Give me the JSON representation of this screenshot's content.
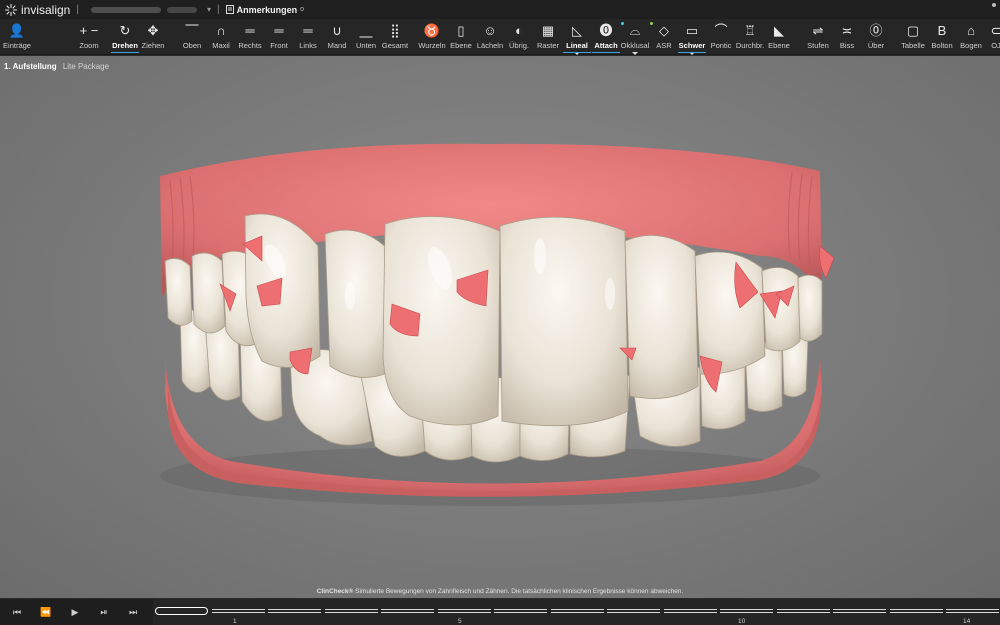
{
  "app": {
    "name": "invisalign",
    "notes_label": "Anmerkungen"
  },
  "toolbar": {
    "tools": [
      {
        "key": "eintraege",
        "label": "Einträge",
        "icon": "person-icon"
      },
      {
        "key": "zoom",
        "label": "Zoom",
        "icon": "zoom-plus-minus-icon"
      },
      {
        "key": "drehen",
        "label": "Drehen",
        "icon": "rotate-icon",
        "active": true
      },
      {
        "key": "ziehen",
        "label": "Ziehen",
        "icon": "move-arrows-icon"
      },
      {
        "key": "oben",
        "label": "Oben",
        "icon": "view-top-icon"
      },
      {
        "key": "maxil",
        "label": "Maxil",
        "icon": "arch-icon"
      },
      {
        "key": "rechts",
        "label": "Rechts",
        "icon": "view-right-icon"
      },
      {
        "key": "front",
        "label": "Front",
        "icon": "view-front-icon"
      },
      {
        "key": "links",
        "label": "Links",
        "icon": "view-left-icon"
      },
      {
        "key": "mand",
        "label": "Mand",
        "icon": "mandible-icon"
      },
      {
        "key": "unten",
        "label": "Unten",
        "icon": "view-bottom-icon"
      },
      {
        "key": "gesamt",
        "label": "Gesamt",
        "icon": "grid-dots-icon"
      },
      {
        "key": "wurzeln",
        "label": "Wurzeln",
        "icon": "tooth-root-icon"
      },
      {
        "key": "ebene",
        "label": "Ebene",
        "icon": "plane-icon"
      },
      {
        "key": "laecheln",
        "label": "Lächeln",
        "icon": "smile-icon"
      },
      {
        "key": "uebrig",
        "label": "Übrig.",
        "icon": "half-circle-icon"
      },
      {
        "key": "raster",
        "label": "Raster",
        "icon": "grid-icon"
      },
      {
        "key": "lineal",
        "label": "Lineal",
        "icon": "ruler-icon",
        "active": true,
        "dropdown": true
      },
      {
        "key": "attach",
        "label": "Attach",
        "icon": "attachment-icon",
        "active": true,
        "dot": "#3fd0e0"
      },
      {
        "key": "okklusal",
        "label": "Okklusal",
        "icon": "occlusal-icon",
        "dot": "#8fd14f",
        "dropdown": true
      },
      {
        "key": "asr",
        "label": "ASR",
        "icon": "diamond-icon"
      },
      {
        "key": "schwer",
        "label": "Schwer",
        "icon": "folder-icon",
        "active": true,
        "dropdown": true
      },
      {
        "key": "pontic",
        "label": "Pontic",
        "icon": "pontic-icon"
      },
      {
        "key": "durchbr",
        "label": "Durchbr.",
        "icon": "eruption-icon"
      },
      {
        "key": "ebene2",
        "label": "Ebene",
        "icon": "ramp-icon"
      },
      {
        "key": "stufen",
        "label": "Stufen",
        "icon": "steps-icon"
      },
      {
        "key": "biss",
        "label": "Biss",
        "icon": "bite-icon"
      },
      {
        "key": "ueber",
        "label": "Über",
        "icon": "overlay-icon"
      },
      {
        "key": "tabelle",
        "label": "Tabelle",
        "icon": "table-icon"
      },
      {
        "key": "bolton",
        "label": "Bolton",
        "icon": "bolton-b-icon"
      },
      {
        "key": "bogen",
        "label": "Bogen",
        "icon": "arch-form-icon"
      },
      {
        "key": "oj",
        "label": "OJ",
        "icon": "overjet-icon"
      }
    ]
  },
  "viewport": {
    "stage_title": "1. Aufstellung",
    "stage_subtitle": "Lite Package",
    "disclaimer_brand": "ClinCheck®",
    "disclaimer_text": "Simulierte Bewegungen von Zahnfleisch und Zähnen. Die tatsächlichen klinischen Ergebnisse können abweichen."
  },
  "timeline": {
    "tick_labels": [
      "1",
      "5",
      "10",
      "14"
    ],
    "segment_count": 15,
    "current_stage": 0
  },
  "colors": {
    "accent": "#39a0e0",
    "gum": "#e07b7b",
    "attachment": "#ee6f72",
    "tooth": "#ece6dc"
  }
}
